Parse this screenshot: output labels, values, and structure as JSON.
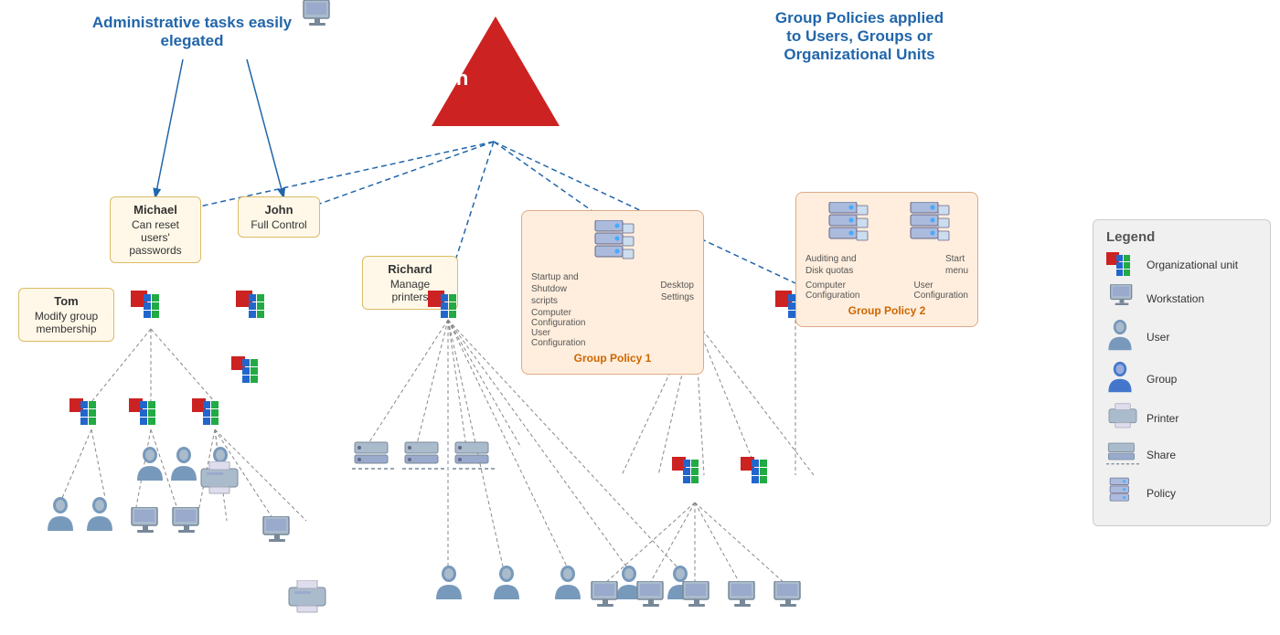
{
  "headings": {
    "admin": "Administrative tasks\neasily elegated",
    "group_policy": "Group Policies applied\nto Users, Groups or\nOrganizational Units",
    "domain": "Domain"
  },
  "info_boxes": {
    "michael": {
      "name": "Michael",
      "desc": "Can reset\nusers'\npasswords"
    },
    "john": {
      "name": "John",
      "desc": "Full Control"
    },
    "tom": {
      "name": "Tom",
      "desc": "Modify group\nmembership"
    },
    "richard": {
      "name": "Richard",
      "desc": "Manage printers"
    }
  },
  "policy_boxes": {
    "gp1": {
      "title": "Group Policy 1",
      "items": [
        "Startup and\nShutdow\nscripts",
        "Desktop\nSettings",
        "Computer\nConfiguration",
        "User\nConfiguration"
      ]
    },
    "gp2": {
      "title": "Group Policy 2",
      "items": [
        "Auditing and\nDisk quotas",
        "Start\nmenu",
        "Computer\nConfiguration",
        "User\nConfiguration"
      ]
    }
  },
  "legend": {
    "title": "Legend",
    "items": [
      {
        "icon": "ou",
        "label": "Organizational unit"
      },
      {
        "icon": "workstation",
        "label": "Workstation"
      },
      {
        "icon": "user",
        "label": "User"
      },
      {
        "icon": "group",
        "label": "Group"
      },
      {
        "icon": "printer",
        "label": "Printer"
      },
      {
        "icon": "share",
        "label": "Share"
      },
      {
        "icon": "policy",
        "label": "Policy"
      }
    ]
  }
}
